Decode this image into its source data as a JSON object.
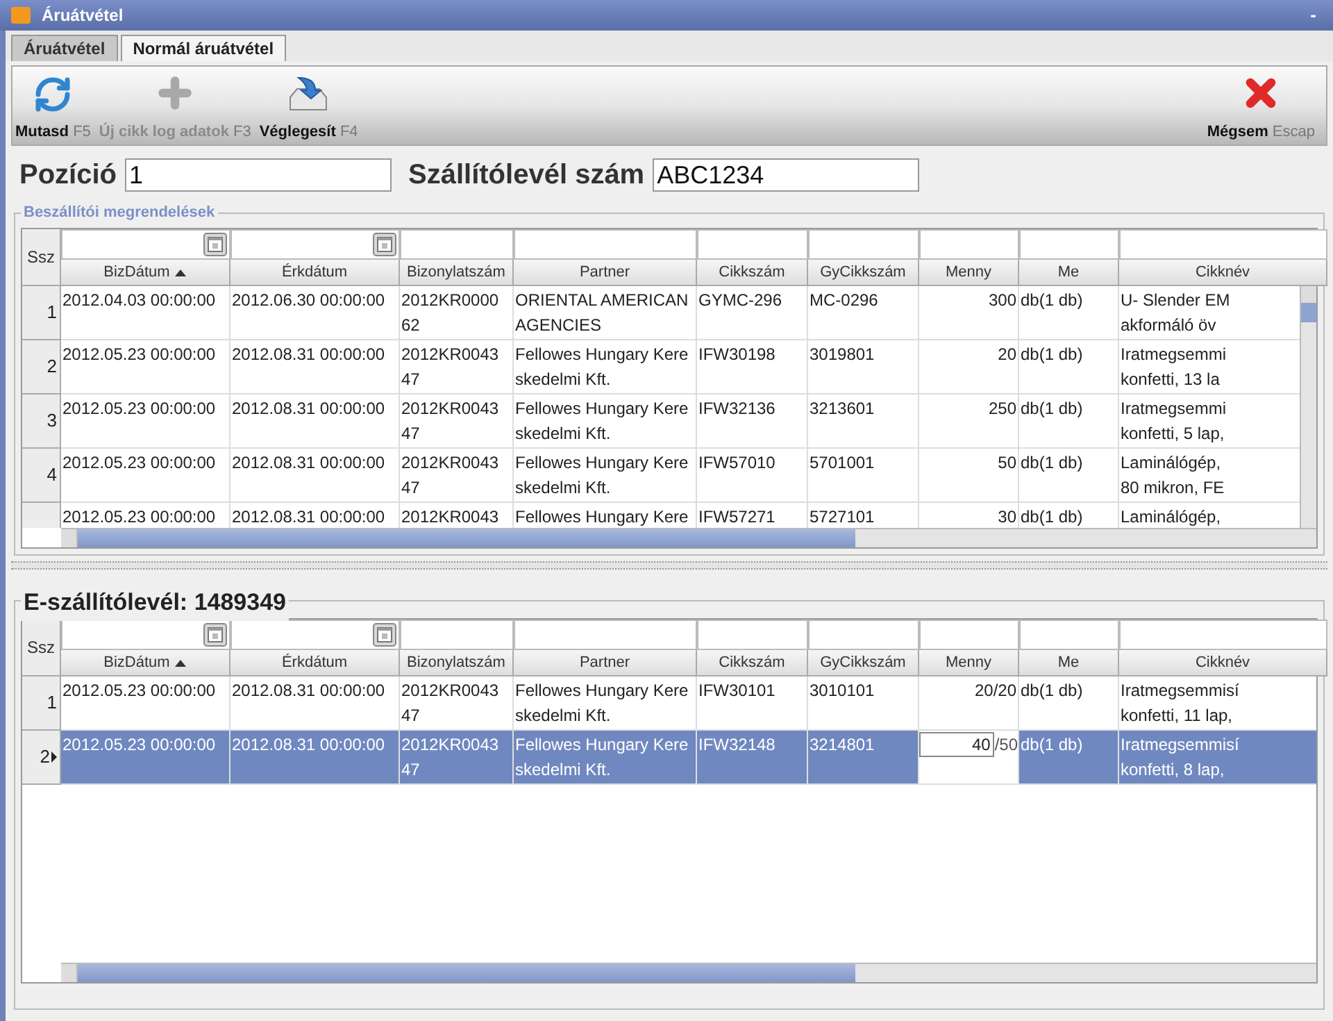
{
  "window": {
    "title": "Áruátvétel",
    "minimize": "-"
  },
  "tabs": [
    {
      "label": "Áruátvétel",
      "selected": false
    },
    {
      "label": "Normál áruátvétel",
      "selected": true
    }
  ],
  "toolbar": [
    {
      "kind": "refresh",
      "label": "Mutasd",
      "shortcut": "F5",
      "disabled": false
    },
    {
      "kind": "add",
      "label": "Új cikk log adatok",
      "shortcut": "F3",
      "disabled": true
    },
    {
      "kind": "finalize",
      "label": "Véglegesít",
      "shortcut": "F4",
      "disabled": false
    },
    {
      "kind": "cancel",
      "label": "Mégsem",
      "shortcut": "Escap",
      "disabled": false
    }
  ],
  "fields": [
    {
      "label": "Pozíció",
      "value": "1"
    },
    {
      "label": "Szállítólevél szám",
      "value": "ABC1234"
    }
  ],
  "orders": {
    "title": "Beszállítói megrendelések",
    "row_header": "Ssz",
    "columns": [
      {
        "label": "BizDátum",
        "sorted_ascending": true,
        "date_filter": true
      },
      {
        "label": "Érkdátum",
        "sorted_ascending": false,
        "date_filter": true
      },
      {
        "label": "Bizonylatszám",
        "sorted_ascending": false,
        "date_filter": false
      },
      {
        "label": "Partner",
        "sorted_ascending": false,
        "date_filter": false
      },
      {
        "label": "Cikkszám",
        "sorted_ascending": false,
        "date_filter": false
      },
      {
        "label": "GyCikkszám",
        "sorted_ascending": false,
        "date_filter": false
      },
      {
        "label": "Menny",
        "sorted_ascending": false,
        "date_filter": false
      },
      {
        "label": "Me",
        "sorted_ascending": false,
        "date_filter": false
      },
      {
        "label": "Cikknév",
        "sorted_ascending": false,
        "date_filter": false
      }
    ],
    "rows": [
      {
        "number": "1",
        "selected": false,
        "cells": [
          {
            "kind": "text",
            "text": "2012.04.03 00:00:00"
          },
          {
            "kind": "text",
            "text": "2012.06.30 00:00:00"
          },
          {
            "kind": "text",
            "text": "2012KR0000\n62"
          },
          {
            "kind": "text",
            "text": "ORIENTAL AMERICAN\nAGENCIES"
          },
          {
            "kind": "text",
            "text": "GYMC-296"
          },
          {
            "kind": "text",
            "text": "MC-0296"
          },
          {
            "kind": "number",
            "text": "300"
          },
          {
            "kind": "text",
            "text": "db(1 db)"
          },
          {
            "kind": "text",
            "text": "U- Slender EM\nakformáló öv"
          }
        ]
      },
      {
        "number": "2",
        "selected": false,
        "cells": [
          {
            "kind": "text",
            "text": "2012.05.23 00:00:00"
          },
          {
            "kind": "text",
            "text": "2012.08.31 00:00:00"
          },
          {
            "kind": "text",
            "text": "2012KR0043\n47"
          },
          {
            "kind": "text",
            "text": "Fellowes Hungary Kere\nskedelmi Kft."
          },
          {
            "kind": "text",
            "text": "IFW30198"
          },
          {
            "kind": "text",
            "text": "3019801"
          },
          {
            "kind": "number",
            "text": "20"
          },
          {
            "kind": "text",
            "text": "db(1 db)"
          },
          {
            "kind": "text",
            "text": "Iratmegsemmi\nkonfetti, 13 la"
          }
        ]
      },
      {
        "number": "3",
        "selected": false,
        "cells": [
          {
            "kind": "text",
            "text": "2012.05.23 00:00:00"
          },
          {
            "kind": "text",
            "text": "2012.08.31 00:00:00"
          },
          {
            "kind": "text",
            "text": "2012KR0043\n47"
          },
          {
            "kind": "text",
            "text": "Fellowes Hungary Kere\nskedelmi Kft."
          },
          {
            "kind": "text",
            "text": "IFW32136"
          },
          {
            "kind": "text",
            "text": "3213601"
          },
          {
            "kind": "number",
            "text": "250"
          },
          {
            "kind": "text",
            "text": "db(1 db)"
          },
          {
            "kind": "text",
            "text": "Iratmegsemmi\nkonfetti, 5 lap,"
          }
        ]
      },
      {
        "number": "4",
        "selected": false,
        "cells": [
          {
            "kind": "text",
            "text": "2012.05.23 00:00:00"
          },
          {
            "kind": "text",
            "text": "2012.08.31 00:00:00"
          },
          {
            "kind": "text",
            "text": "2012KR0043\n47"
          },
          {
            "kind": "text",
            "text": "Fellowes Hungary Kere\nskedelmi Kft."
          },
          {
            "kind": "text",
            "text": "IFW57010"
          },
          {
            "kind": "text",
            "text": "5701001"
          },
          {
            "kind": "number",
            "text": "50"
          },
          {
            "kind": "text",
            "text": "db(1 db)"
          },
          {
            "kind": "text",
            "text": "Laminálógép,\n80 mikron, FE"
          }
        ]
      },
      {
        "number": "",
        "selected": false,
        "cells": [
          {
            "kind": "text",
            "text": "2012.05.23 00:00:00"
          },
          {
            "kind": "text",
            "text": "2012.08.31 00:00:00"
          },
          {
            "kind": "text",
            "text": "2012KR0043"
          },
          {
            "kind": "text",
            "text": "Fellowes Hungary Kere"
          },
          {
            "kind": "text",
            "text": "IFW57271"
          },
          {
            "kind": "text",
            "text": "5727101"
          },
          {
            "kind": "number",
            "text": "30"
          },
          {
            "kind": "text",
            "text": "db(1 db)"
          },
          {
            "kind": "text",
            "text": "Laminálógép,"
          }
        ]
      }
    ]
  },
  "delivery": {
    "title": "E-szállítólevél: 1489349",
    "row_header": "Ssz",
    "columns": [
      {
        "label": "BizDátum",
        "sorted_ascending": true,
        "date_filter": true
      },
      {
        "label": "Érkdátum",
        "sorted_ascending": false,
        "date_filter": true
      },
      {
        "label": "Bizonylatszám",
        "sorted_ascending": false,
        "date_filter": false
      },
      {
        "label": "Partner",
        "sorted_ascending": false,
        "date_filter": false
      },
      {
        "label": "Cikkszám",
        "sorted_ascending": false,
        "date_filter": false
      },
      {
        "label": "GyCikkszám",
        "sorted_ascending": false,
        "date_filter": false
      },
      {
        "label": "Menny",
        "sorted_ascending": false,
        "date_filter": false
      },
      {
        "label": "Me",
        "sorted_ascending": false,
        "date_filter": false
      },
      {
        "label": "Cikknév",
        "sorted_ascending": false,
        "date_filter": false
      }
    ],
    "rows": [
      {
        "number": "1",
        "selected": false,
        "cells": [
          {
            "kind": "text",
            "text": "2012.05.23 00:00:00"
          },
          {
            "kind": "text",
            "text": "2012.08.31 00:00:00"
          },
          {
            "kind": "text",
            "text": "2012KR0043\n47"
          },
          {
            "kind": "text",
            "text": "Fellowes Hungary Kere\nskedelmi Kft."
          },
          {
            "kind": "text",
            "text": "IFW30101"
          },
          {
            "kind": "text",
            "text": "3010101"
          },
          {
            "kind": "number",
            "text": "20/20"
          },
          {
            "kind": "text",
            "text": "db(1 db)"
          },
          {
            "kind": "text",
            "text": "Iratmegsemmisí\nkonfetti, 11 lap,"
          }
        ]
      },
      {
        "number": "2",
        "selected": true,
        "cells": [
          {
            "kind": "text",
            "text": "2012.05.23 00:00:00"
          },
          {
            "kind": "text",
            "text": "2012.08.31 00:00:00"
          },
          {
            "kind": "text",
            "text": "2012KR0043\n47"
          },
          {
            "kind": "text",
            "text": "Fellowes Hungary Kere\nskedelmi Kft."
          },
          {
            "kind": "text",
            "text": "IFW32148"
          },
          {
            "kind": "text",
            "text": "3214801"
          },
          {
            "kind": "input",
            "value": "40",
            "suffix": "/50"
          },
          {
            "kind": "text",
            "text": "db(1 db)"
          },
          {
            "kind": "text",
            "text": "Iratmegsemmisí\nkonfetti, 8 lap,"
          }
        ]
      }
    ]
  }
}
